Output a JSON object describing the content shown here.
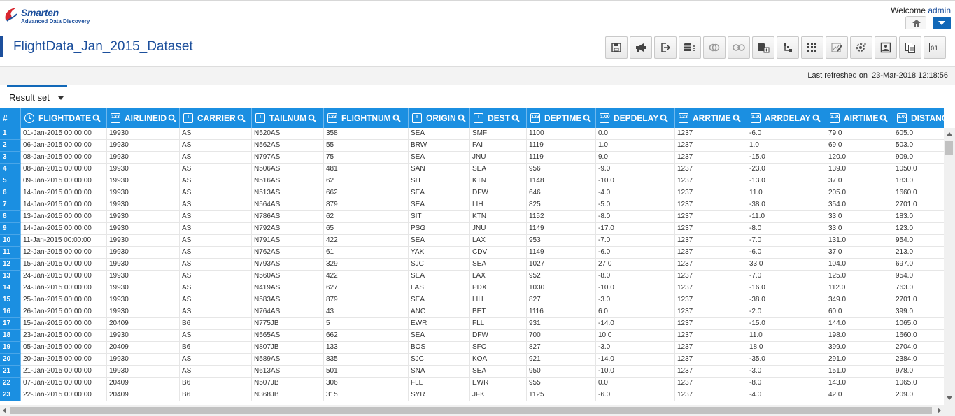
{
  "app": {
    "logo_title": "Smarten",
    "logo_subtitle": "Advanced Data Discovery"
  },
  "header": {
    "welcome": "Welcome",
    "user": "admin"
  },
  "page": {
    "title": "FlightData_Jan_2015_Dataset"
  },
  "toolbar": [
    {
      "icon": "save-icon"
    },
    {
      "icon": "megaphone-icon"
    },
    {
      "icon": "exit-icon"
    },
    {
      "icon": "database-list-icon"
    },
    {
      "icon": "join-circles-icon"
    },
    {
      "icon": "link-circles-icon"
    },
    {
      "icon": "database-add-icon"
    },
    {
      "icon": "hierarchy-icon"
    },
    {
      "icon": "grid-icon"
    },
    {
      "icon": "edit-chart-icon"
    },
    {
      "icon": "settings-icon"
    },
    {
      "icon": "image-icon"
    },
    {
      "icon": "copy-icon"
    },
    {
      "icon": "binary-icon"
    }
  ],
  "refresh": {
    "label": "Last refreshed on",
    "timestamp": "23-Mar-2018 12:18:56"
  },
  "tab": {
    "label": "Result set"
  },
  "grid": {
    "rownum_header": "#",
    "columns": [
      {
        "name": "FLIGHTDATE",
        "type": "date"
      },
      {
        "name": "AIRLINEID",
        "type": "123"
      },
      {
        "name": "CARRIER",
        "type": "T"
      },
      {
        "name": "TAILNUM",
        "type": "T"
      },
      {
        "name": "FLIGHTNUM",
        "type": "123"
      },
      {
        "name": "ORIGIN",
        "type": "T"
      },
      {
        "name": "DEST",
        "type": "T"
      },
      {
        "name": "DEPTIME",
        "type": "123"
      },
      {
        "name": "DEPDELAY",
        "type": "1.00"
      },
      {
        "name": "ARRTIME",
        "type": "123"
      },
      {
        "name": "ARRDELAY",
        "type": "1.00"
      },
      {
        "name": "AIRTIME",
        "type": "1.00"
      },
      {
        "name": "DISTANC",
        "type": "1.00"
      }
    ],
    "rows": [
      [
        "1",
        "01-Jan-2015 00:00:00",
        "19930",
        "AS",
        "N520AS",
        "358",
        "SEA",
        "SMF",
        "1100",
        "0.0",
        "1237",
        "-6.0",
        "79.0",
        "605.0"
      ],
      [
        "2",
        "06-Jan-2015 00:00:00",
        "19930",
        "AS",
        "N562AS",
        "55",
        "BRW",
        "FAI",
        "1119",
        "1.0",
        "1237",
        "1.0",
        "69.0",
        "503.0"
      ],
      [
        "3",
        "08-Jan-2015 00:00:00",
        "19930",
        "AS",
        "N797AS",
        "75",
        "SEA",
        "JNU",
        "1119",
        "9.0",
        "1237",
        "-15.0",
        "120.0",
        "909.0"
      ],
      [
        "4",
        "08-Jan-2015 00:00:00",
        "19930",
        "AS",
        "N506AS",
        "481",
        "SAN",
        "SEA",
        "956",
        "-9.0",
        "1237",
        "-23.0",
        "139.0",
        "1050.0"
      ],
      [
        "5",
        "09-Jan-2015 00:00:00",
        "19930",
        "AS",
        "N516AS",
        "62",
        "SIT",
        "KTN",
        "1148",
        "-10.0",
        "1237",
        "-13.0",
        "37.0",
        "183.0"
      ],
      [
        "6",
        "14-Jan-2015 00:00:00",
        "19930",
        "AS",
        "N513AS",
        "662",
        "SEA",
        "DFW",
        "646",
        "-4.0",
        "1237",
        "11.0",
        "205.0",
        "1660.0"
      ],
      [
        "7",
        "14-Jan-2015 00:00:00",
        "19930",
        "AS",
        "N564AS",
        "879",
        "SEA",
        "LIH",
        "825",
        "-5.0",
        "1237",
        "-38.0",
        "354.0",
        "2701.0"
      ],
      [
        "8",
        "13-Jan-2015 00:00:00",
        "19930",
        "AS",
        "N786AS",
        "62",
        "SIT",
        "KTN",
        "1152",
        "-8.0",
        "1237",
        "-11.0",
        "33.0",
        "183.0"
      ],
      [
        "9",
        "14-Jan-2015 00:00:00",
        "19930",
        "AS",
        "N792AS",
        "65",
        "PSG",
        "JNU",
        "1149",
        "-17.0",
        "1237",
        "-8.0",
        "33.0",
        "123.0"
      ],
      [
        "10",
        "11-Jan-2015 00:00:00",
        "19930",
        "AS",
        "N791AS",
        "422",
        "SEA",
        "LAX",
        "953",
        "-7.0",
        "1237",
        "-7.0",
        "131.0",
        "954.0"
      ],
      [
        "11",
        "12-Jan-2015 00:00:00",
        "19930",
        "AS",
        "N762AS",
        "61",
        "YAK",
        "CDV",
        "1149",
        "-6.0",
        "1237",
        "-6.0",
        "37.0",
        "213.0"
      ],
      [
        "12",
        "15-Jan-2015 00:00:00",
        "19930",
        "AS",
        "N793AS",
        "329",
        "SJC",
        "SEA",
        "1027",
        "27.0",
        "1237",
        "33.0",
        "104.0",
        "697.0"
      ],
      [
        "13",
        "24-Jan-2015 00:00:00",
        "19930",
        "AS",
        "N560AS",
        "422",
        "SEA",
        "LAX",
        "952",
        "-8.0",
        "1237",
        "-7.0",
        "125.0",
        "954.0"
      ],
      [
        "14",
        "24-Jan-2015 00:00:00",
        "19930",
        "AS",
        "N419AS",
        "627",
        "LAS",
        "PDX",
        "1030",
        "-10.0",
        "1237",
        "-16.0",
        "112.0",
        "763.0"
      ],
      [
        "15",
        "25-Jan-2015 00:00:00",
        "19930",
        "AS",
        "N583AS",
        "879",
        "SEA",
        "LIH",
        "827",
        "-3.0",
        "1237",
        "-38.0",
        "349.0",
        "2701.0"
      ],
      [
        "16",
        "26-Jan-2015 00:00:00",
        "19930",
        "AS",
        "N764AS",
        "43",
        "ANC",
        "BET",
        "1116",
        "6.0",
        "1237",
        "-2.0",
        "60.0",
        "399.0"
      ],
      [
        "17",
        "15-Jan-2015 00:00:00",
        "20409",
        "B6",
        "N775JB",
        "5",
        "EWR",
        "FLL",
        "931",
        "-14.0",
        "1237",
        "-15.0",
        "144.0",
        "1065.0"
      ],
      [
        "18",
        "23-Jan-2015 00:00:00",
        "19930",
        "AS",
        "N565AS",
        "662",
        "SEA",
        "DFW",
        "700",
        "10.0",
        "1237",
        "11.0",
        "198.0",
        "1660.0"
      ],
      [
        "19",
        "05-Jan-2015 00:00:00",
        "20409",
        "B6",
        "N807JB",
        "133",
        "BOS",
        "SFO",
        "827",
        "-3.0",
        "1237",
        "18.0",
        "399.0",
        "2704.0"
      ],
      [
        "20",
        "20-Jan-2015 00:00:00",
        "19930",
        "AS",
        "N589AS",
        "835",
        "SJC",
        "KOA",
        "921",
        "-14.0",
        "1237",
        "-35.0",
        "291.0",
        "2384.0"
      ],
      [
        "21",
        "21-Jan-2015 00:00:00",
        "19930",
        "AS",
        "N613AS",
        "501",
        "SNA",
        "SEA",
        "950",
        "-10.0",
        "1237",
        "-3.0",
        "151.0",
        "978.0"
      ],
      [
        "22",
        "07-Jan-2015 00:00:00",
        "20409",
        "B6",
        "N507JB",
        "306",
        "FLL",
        "EWR",
        "955",
        "0.0",
        "1237",
        "-8.0",
        "143.0",
        "1065.0"
      ],
      [
        "23",
        "22-Jan-2015 00:00:00",
        "20409",
        "B6",
        "N368JB",
        "315",
        "SYR",
        "JFK",
        "1125",
        "-6.0",
        "1237",
        "-4.0",
        "42.0",
        "209.0"
      ]
    ]
  }
}
